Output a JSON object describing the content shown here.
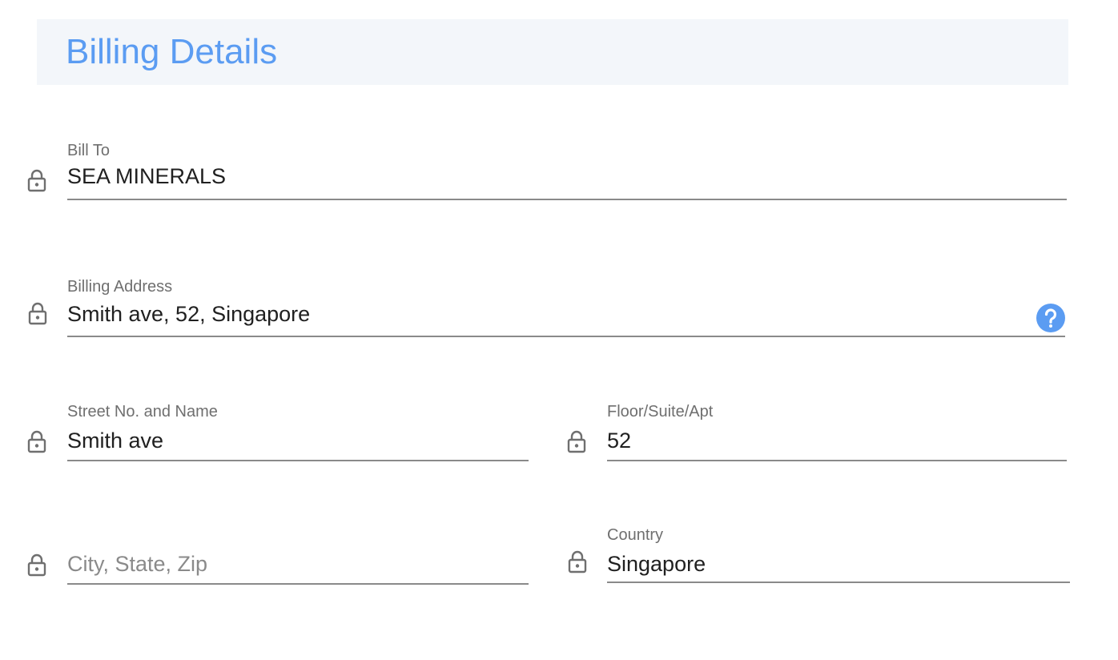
{
  "header": {
    "title": "Billing Details"
  },
  "fields": {
    "bill_to": {
      "label": "Bill To",
      "value": "SEA MINERALS"
    },
    "billing_address": {
      "label": "Billing Address",
      "value": "Smith ave, 52, Singapore"
    },
    "street": {
      "label": "Street No. and Name",
      "value": "Smith ave"
    },
    "floor": {
      "label": "Floor/Suite/Apt",
      "value": "52"
    },
    "city": {
      "label": "",
      "value": "",
      "placeholder": "City, State, Zip"
    },
    "country": {
      "label": "Country",
      "value": "Singapore"
    }
  },
  "icons": {
    "lock": "lock-icon",
    "help": "help-circle-icon"
  },
  "colors": {
    "accent": "#5b9cf2",
    "header_background": "#f3f6fa",
    "icon": "#6f6f6f",
    "text": "#202020",
    "label": "#6f6f6f",
    "underline": "#8a8a8a"
  }
}
